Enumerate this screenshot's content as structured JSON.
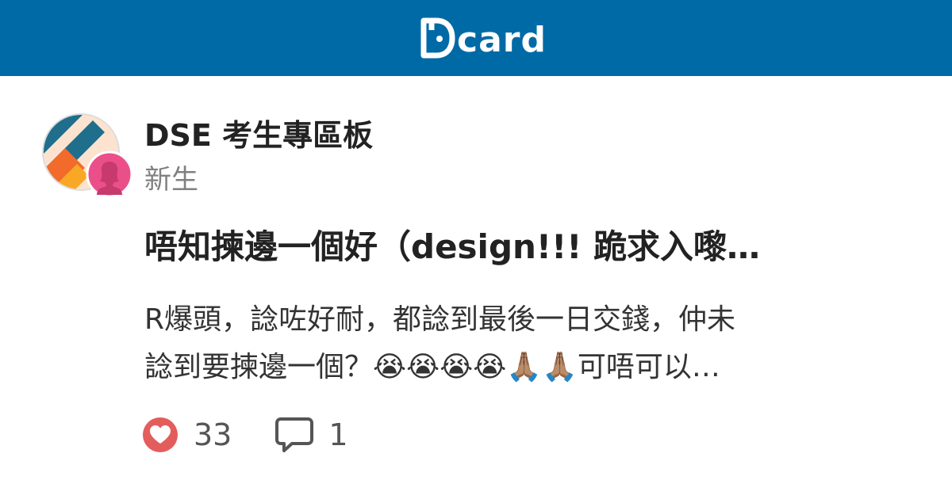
{
  "header": {
    "logo_text": "card",
    "brand_color": "#006AA6"
  },
  "forum": {
    "name": "DSE 考生專區板",
    "avatar_icon": "forum-avatar-icon"
  },
  "author": {
    "label": "新生",
    "avatar_icon": "female-avatar-icon"
  },
  "post": {
    "title": "唔知揀邊一個好（design!!! 跪求入嚟…",
    "excerpt_line1": "R爆頭，諗咗好耐，都諗到最後一日交錢，仲未",
    "excerpt_line2": "諗到要揀邊一個？😭😭😭😭🙏🏽🙏🏽可唔可以…"
  },
  "stats": {
    "likes": "33",
    "comments": "1",
    "like_icon": "heart-icon",
    "comment_icon": "comment-icon",
    "like_color": "#E35D5D"
  }
}
